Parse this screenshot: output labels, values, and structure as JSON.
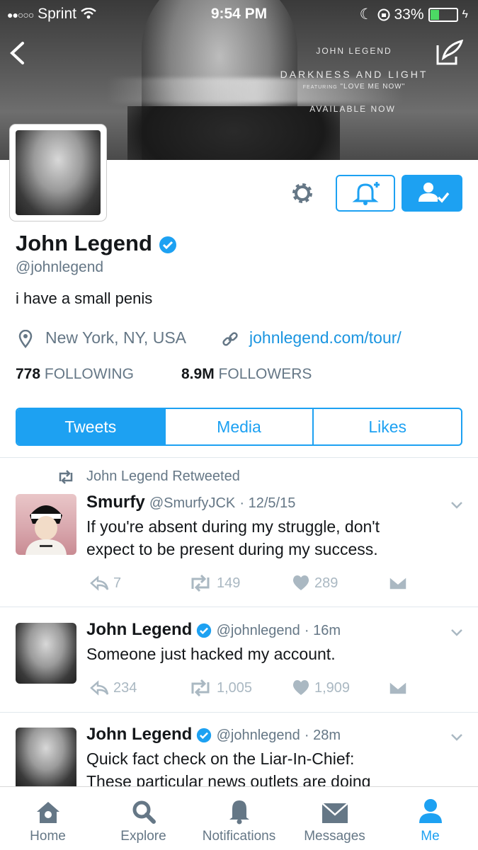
{
  "status_bar": {
    "carrier": "Sprint",
    "time": "9:54 PM",
    "battery": "33%"
  },
  "banner": {
    "artist": "JOHN LEGEND",
    "album": "DARKNESS AND LIGHT",
    "featuring_prefix": "FEATURING",
    "featuring": "\"LOVE ME NOW\"",
    "available": "AVAILABLE NOW"
  },
  "profile": {
    "name": "John Legend",
    "handle": "@johnlegend",
    "bio": "i have a small penis",
    "location": "New York, NY, USA",
    "website": "johnlegend.com/tour/",
    "following_count": "778",
    "following_label": "FOLLOWING",
    "followers_count": "8.9M",
    "followers_label": "FOLLOWERS"
  },
  "tabs": [
    {
      "label": "Tweets"
    },
    {
      "label": "Media"
    },
    {
      "label": "Likes"
    }
  ],
  "tweets": [
    {
      "retweet_note": "John Legend Retweeted",
      "name": "Smurfy",
      "handle": "@SmurfyJCK",
      "time": "· 12/5/15",
      "text_line1": "If you're absent during my struggle, don't",
      "text_line2": "expect to be present during my success.",
      "replies": "7",
      "retweets": "149",
      "likes": "289"
    },
    {
      "name": "John Legend",
      "handle": "@johnlegend",
      "time": "· 16m",
      "text_line1": "Someone just hacked my account.",
      "replies": "234",
      "retweets": "1,005",
      "likes": "1,909"
    },
    {
      "name": "John Legend",
      "handle": "@johnlegend",
      "time": "· 28m",
      "text_line1": "Quick fact check on the Liar-In-Chief:",
      "text_line2": "These particular news outlets are doing"
    }
  ],
  "tabbar": [
    {
      "label": "Home"
    },
    {
      "label": "Explore"
    },
    {
      "label": "Notifications"
    },
    {
      "label": "Messages"
    },
    {
      "label": "Me"
    }
  ],
  "colors": {
    "accent": "#1da1f2",
    "muted": "#657786",
    "action": "#aab8c2"
  }
}
